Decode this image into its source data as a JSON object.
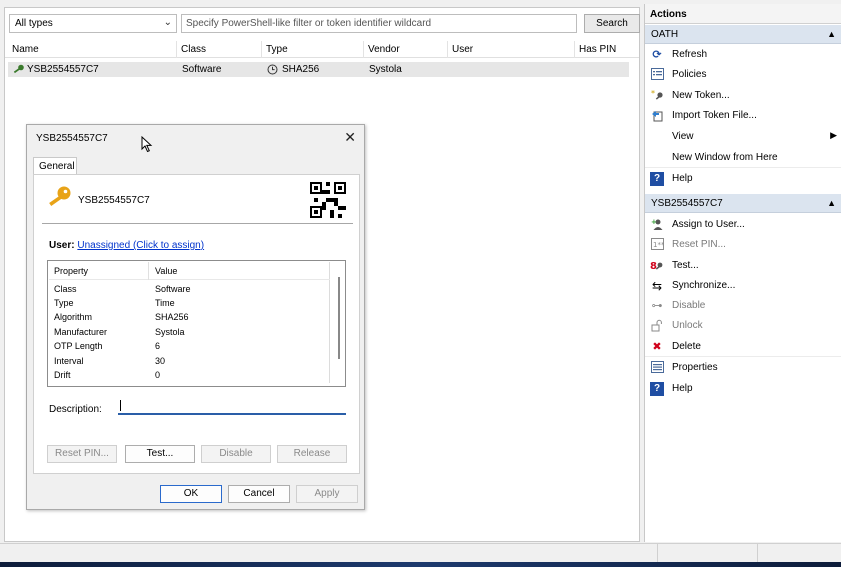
{
  "toolbar": {
    "type_select": "All types",
    "filter_placeholder": "Specify PowerShell-like filter or token identifier wildcard",
    "search_label": "Search"
  },
  "grid": {
    "columns": [
      "Name",
      "Class",
      "Type",
      "Vendor",
      "User",
      "Has PIN"
    ],
    "rows": [
      {
        "name": "YSB2554557C7",
        "class": "Software",
        "type": "SHA256",
        "vendor": "Systola",
        "user": "",
        "has_pin": ""
      }
    ]
  },
  "dialog": {
    "title": "YSB2554557C7",
    "tab": "General",
    "token_name": "YSB2554557C7",
    "user_label": "User:",
    "user_link": "Unassigned (Click to assign)",
    "prop_headers": [
      "Property",
      "Value"
    ],
    "properties": [
      {
        "k": "Class",
        "v": "Software"
      },
      {
        "k": "Type",
        "v": "Time"
      },
      {
        "k": "Algorithm",
        "v": "SHA256"
      },
      {
        "k": "Manufacturer",
        "v": "Systola"
      },
      {
        "k": "OTP Length",
        "v": "6"
      },
      {
        "k": "Interval",
        "v": "30"
      },
      {
        "k": "Drift",
        "v": "0"
      }
    ],
    "description_label": "Description:",
    "description_value": "",
    "buttons": {
      "reset_pin": "Reset PIN...",
      "test": "Test...",
      "disable": "Disable",
      "release": "Release",
      "ok": "OK",
      "cancel": "Cancel",
      "apply": "Apply"
    }
  },
  "actions": {
    "title": "Actions",
    "sections": [
      {
        "header": "OATH",
        "items": [
          {
            "label": "Refresh",
            "icon": "refresh-icon",
            "disabled": false
          },
          {
            "label": "Policies",
            "icon": "policies-icon",
            "disabled": false
          },
          {
            "label": "New Token...",
            "icon": "new-token-icon",
            "disabled": false
          },
          {
            "label": "Import Token File...",
            "icon": "import-icon",
            "disabled": false
          },
          {
            "label": "View",
            "icon": "",
            "disabled": false,
            "submenu": true
          },
          {
            "label": "New Window from Here",
            "icon": "",
            "disabled": false
          },
          {
            "label": "Help",
            "icon": "help-icon",
            "disabled": false
          }
        ]
      },
      {
        "header": "YSB2554557C7",
        "items": [
          {
            "label": "Assign to User...",
            "icon": "assign-user-icon",
            "disabled": false
          },
          {
            "label": "Reset PIN...",
            "icon": "reset-pin-icon",
            "disabled": true
          },
          {
            "label": "Test...",
            "icon": "test-icon",
            "disabled": false
          },
          {
            "label": "Synchronize...",
            "icon": "sync-icon",
            "disabled": false
          },
          {
            "label": "Disable",
            "icon": "disable-icon",
            "disabled": true
          },
          {
            "label": "Unlock",
            "icon": "unlock-icon",
            "disabled": true
          },
          {
            "label": "Delete",
            "icon": "delete-icon",
            "disabled": false
          },
          {
            "label": "Properties",
            "icon": "properties-icon",
            "disabled": false
          },
          {
            "label": "Help",
            "icon": "help-icon",
            "disabled": false
          }
        ]
      }
    ]
  },
  "colors": {
    "section_header": "#dbe4ef",
    "link": "#0033cc",
    "delete_red": "#d0021b",
    "help_blue": "#1f4ea3",
    "key_gold": "#e8a317"
  }
}
